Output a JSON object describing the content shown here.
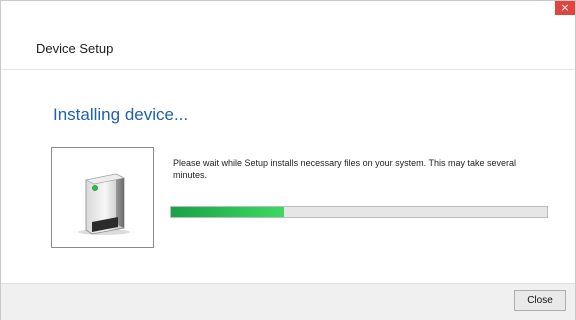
{
  "window": {
    "title": "Device Setup",
    "close_glyph": "×"
  },
  "main": {
    "heading": "Installing device...",
    "message": "Please wait while Setup installs necessary files on your system. This may take several minutes.",
    "progress_fraction": 0.3,
    "device_icon": "printer-device-icon"
  },
  "footer": {
    "close_label": "Close"
  },
  "colors": {
    "heading": "#1f5eb5",
    "progress": "#2fcb56",
    "titlebar_close": "#e0443e"
  }
}
